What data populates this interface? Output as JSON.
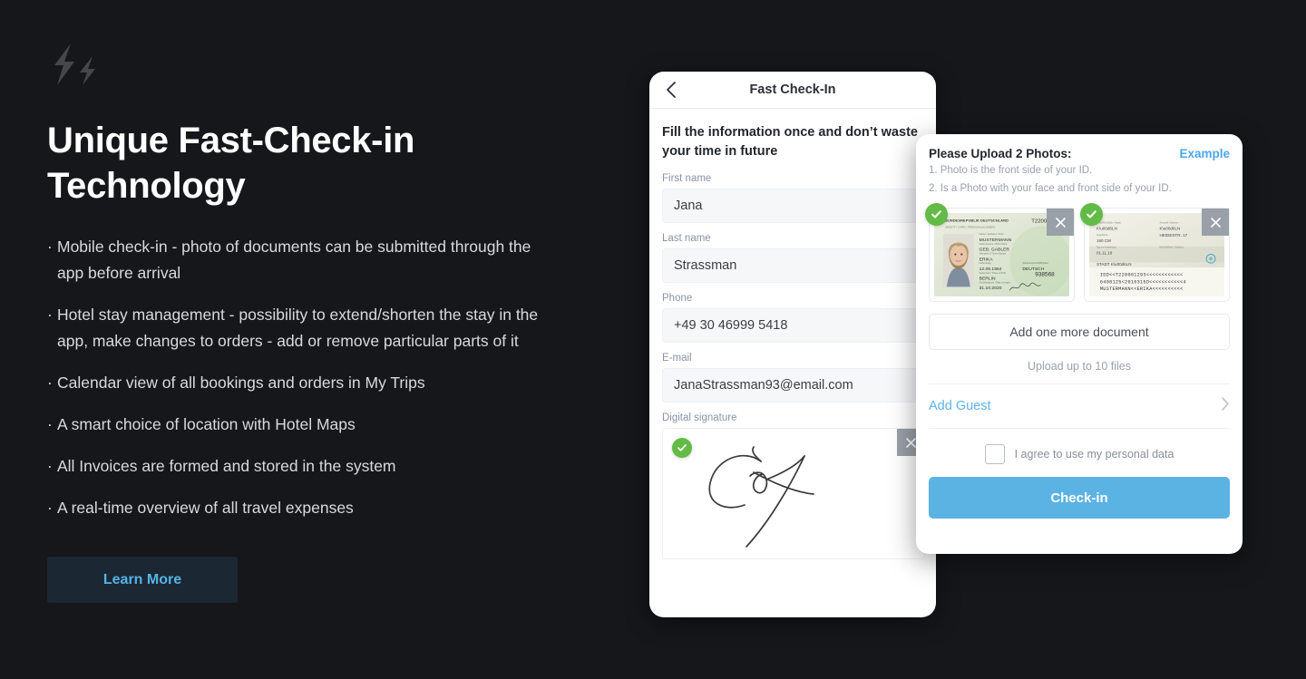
{
  "brand": {
    "logo_icon": "double-lightning-bolt-icon",
    "accent_blue": "#55b3e8",
    "background": "#16171b"
  },
  "hero": {
    "headline": "Unique Fast-Check-in Technology",
    "bullets": [
      "Mobile check-in - photo of documents can be submitted through the app before arrival",
      "Hotel stay management - possibility to extend/shorten the stay in the app, make changes to orders - add or remove particular parts of it",
      "Calendar view of all bookings and orders in My Trips",
      "A smart choice of location with Hotel Maps",
      "All Invoices are formed and stored in the system",
      "A real-time overview of all travel expenses"
    ],
    "bullet_marker": "·",
    "cta_label": "Learn More"
  },
  "phone": {
    "back_icon": "chevron-left-icon",
    "title": "Fast Check-In",
    "subtitle": "Fill the information once and don’t waste your time in future",
    "fields": [
      {
        "label": "First name",
        "value": "Jana"
      },
      {
        "label": "Last name",
        "value": "Strassman"
      },
      {
        "label": "Phone",
        "value": "+49 30 46999 5418"
      },
      {
        "label": "E-mail",
        "value": "JanaStrassman93@email.com"
      }
    ],
    "signature": {
      "label": "Digital signature",
      "status_icon": "green-check-icon",
      "remove_icon": "close-x-icon",
      "alt": "handwritten signature Cox"
    }
  },
  "upload": {
    "title": "Please Upload 2 Photos:",
    "example_link": "Example",
    "instruction_1": "1. Photo is the front side of your ID.",
    "instruction_2": "2. Is a Photo with your face and front side of your ID.",
    "documents": [
      {
        "name": "id-card-front",
        "status_icon": "green-check-icon",
        "remove_icon": "close-x-icon",
        "country_header": "BUNDESREPUBLIK DEUTSCHLAND",
        "doc_number": "T2200",
        "surname": "MUSTERMANN",
        "birth_name": "GEB. GABLER",
        "given_name": "ERIKA",
        "birth_date": "12.08.1964",
        "nationality": "DEUTSCH",
        "birth_place": "BERLIN",
        "expiry": "31.10.2020",
        "access_number": "938568"
      },
      {
        "name": "id-card-back",
        "status_icon": "green-check-icon",
        "remove_icon": "close-x-icon",
        "height": "160 cm",
        "eye_color_line": "01.11.10",
        "city": "KÖLN",
        "street": "HEIDESTR. 17",
        "authority": "STADT KÖLN",
        "mrz_line_1": "IDD<<T220001293<<<<<<<<<<<<<<<",
        "mrz_line_2": "6408125<2010315D<<<<<<<<<<<<<4",
        "mrz_line_3": "MUSTERMANN<<ERIKA<<<<<<<<<<<<<"
      }
    ],
    "add_document_label": "Add one more document",
    "upload_note": "Upload up to 10 files",
    "add_guest_label": "Add Guest",
    "add_guest_icon": "chevron-right-icon",
    "agree_label": "I agree to use my personal data",
    "agree_checked": false,
    "submit_label": "Check-in",
    "submit_color": "#5bb3e4"
  }
}
